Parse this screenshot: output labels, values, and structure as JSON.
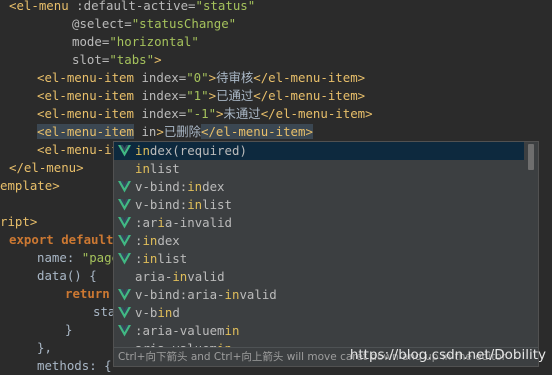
{
  "code": {
    "l1_tag": "<el-menu",
    "l1_attr": " :default-active=",
    "l1_str": "\"status\"",
    "l2_attr": "@select=",
    "l2_str": "\"statusChange\"",
    "l3_attr": "mode=",
    "l3_str": "\"horizontal\"",
    "l4_attr": "slot=",
    "l4_str": "\"tabs\"",
    "l4_tag": ">",
    "l5_tag_open": "<el-menu-item",
    "l5_attr": " index=",
    "l5_str": "\"0\"",
    "l5_gt": ">",
    "l5_text": "待审核",
    "l5_close": "</el-menu-item>",
    "l6_str": "\"1\"",
    "l6_text": "已通过",
    "l7_str": "\"-1\"",
    "l7_text": "未通过",
    "l8_attr": " in",
    "l8_text": "已删除",
    "l9_tag": "<el-menu-it",
    "l10_tag": "</el-menu>",
    "l11_tag": "emplate>",
    "l13_tag": "ript>",
    "l14_kw": "export default",
    "l15_attr": "name: ",
    "l15_str": "\"page",
    "l16_text": "data() {",
    "l17_kw": "return",
    "l18_text": "sta",
    "l19_text": "}",
    "l20_text": "},",
    "l21_text": "methods: {"
  },
  "completion": {
    "items": [
      {
        "pre": "",
        "match": "in",
        "post": "dex(required)",
        "vue": true
      },
      {
        "pre": "",
        "match": "in",
        "post": "list",
        "vue": false
      },
      {
        "pre": "v-bind:",
        "match": "in",
        "post": "dex",
        "vue": true
      },
      {
        "pre": "v-bind:",
        "match": "in",
        "post": "list",
        "vue": true
      },
      {
        "pre": ":ar",
        "match": "i",
        "post": "a-invalid",
        "vue": true
      },
      {
        "pre": ":",
        "match": "in",
        "post": "dex",
        "vue": true
      },
      {
        "pre": ":",
        "match": "in",
        "post": "list",
        "vue": true
      },
      {
        "pre": "aria-",
        "match": "in",
        "post": "valid",
        "vue": false
      },
      {
        "pre": "v-bind:aria-",
        "match": "in",
        "post": "valid",
        "vue": true
      },
      {
        "pre": "v-b",
        "match": "in",
        "post": "d",
        "vue": true
      },
      {
        "pre": ":aria-valuem",
        "match": "in",
        "post": "",
        "vue": true
      },
      {
        "pre": "aria-valuem",
        "match": "in",
        "post": "",
        "vue": false
      }
    ],
    "hint": "Ctrl+向下箭头 and Ctrl+向上箭头 will move caret down and up in the editor",
    "selected_index": 0
  },
  "watermark": "https://blog.csdn.net/Dobility",
  "colors": {
    "tag": "#e8bf6a",
    "string": "#a5c25c",
    "keyword": "#cc7832",
    "vue_green": "#41b883",
    "selection": "#0d293e",
    "background": "#2b2b2b"
  }
}
